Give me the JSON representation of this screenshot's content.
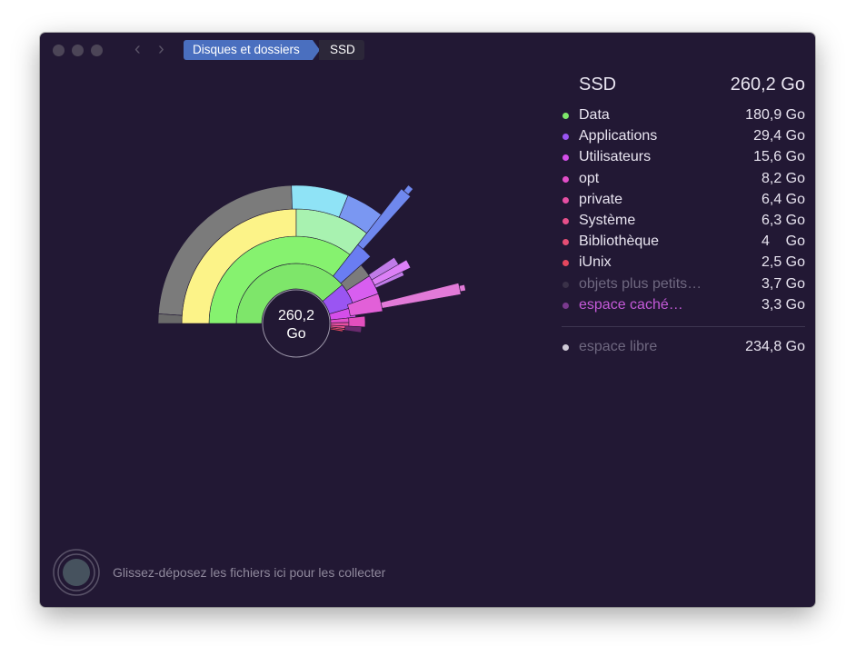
{
  "toolbar": {
    "breadcrumbs": [
      "Disques et dossiers",
      "SSD"
    ]
  },
  "sunburst": {
    "center_value": "260,2",
    "center_unit": "Go"
  },
  "legend": {
    "title": "SSD",
    "total": "260,2 Go",
    "items": [
      {
        "label": "Data",
        "value": "180,9 Go",
        "color": "#7ee66a"
      },
      {
        "label": "Applications",
        "value": "29,4 Go",
        "color": "#9a55f2"
      },
      {
        "label": "Utilisateurs",
        "value": "15,6 Go",
        "color": "#d44ee9"
      },
      {
        "label": "opt",
        "value": "8,2 Go",
        "color": "#e24ec8"
      },
      {
        "label": "private",
        "value": "6,4 Go",
        "color": "#e64fa3"
      },
      {
        "label": "Système",
        "value": "6,3 Go",
        "color": "#e7508a"
      },
      {
        "label": "Bibliothèque",
        "value": "4    Go",
        "color": "#e54e74"
      },
      {
        "label": "iUnix",
        "value": "2,5 Go",
        "color": "#e4475e"
      },
      {
        "label": "objets plus petits…",
        "value": "3,7 Go",
        "color": "#3a3148"
      },
      {
        "label": "espace caché…",
        "value": "3,3 Go",
        "color": "#7a3a8e"
      }
    ],
    "free_label": "espace libre",
    "free_value": "234,8 Go",
    "free_color": "#cfcad6"
  },
  "dropzone": {
    "text": "Glissez-déposez les fichiers ici pour les collecter"
  }
}
